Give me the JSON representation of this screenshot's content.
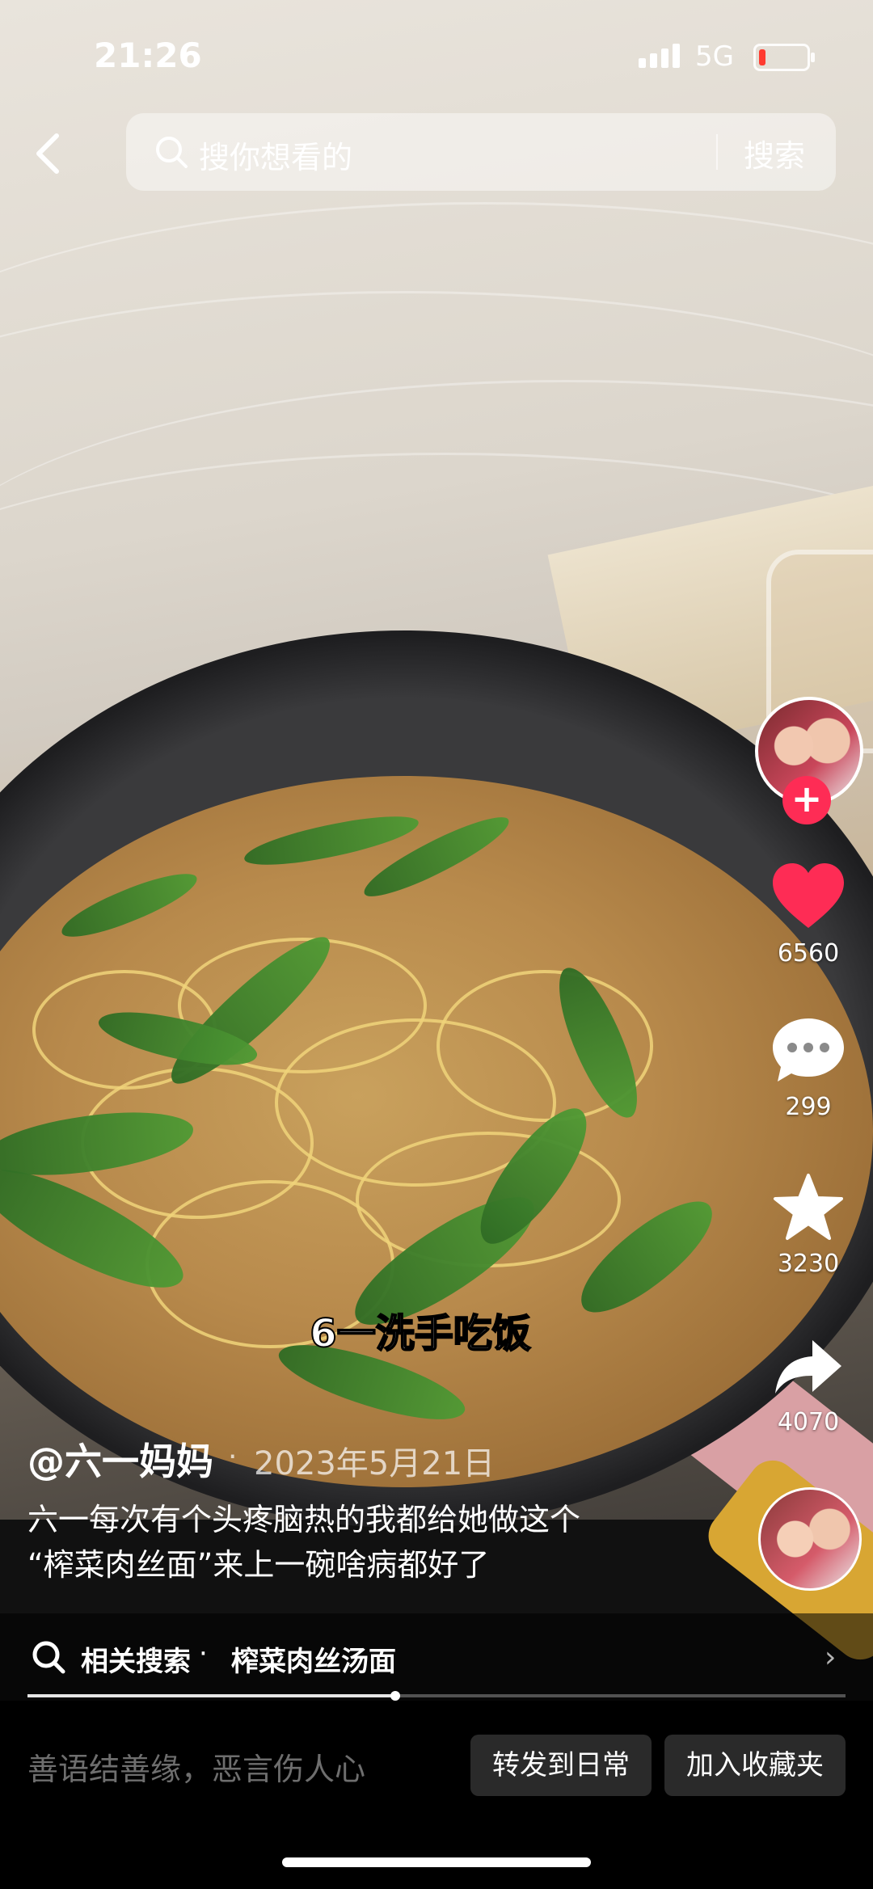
{
  "status_bar": {
    "time": "21:26",
    "network": "5G",
    "battery_fraction": 0.15,
    "battery_color": "#ff3b30"
  },
  "search": {
    "placeholder": "搜你想看的",
    "button_label": "搜索",
    "back_icon": "chevron-left-icon"
  },
  "video": {
    "caption_overlay": "6一洗手吃饭",
    "progress": 0.45
  },
  "sidebar": {
    "like_count": "6560",
    "comment_count": "299",
    "favorite_count": "3230",
    "share_count": "4070",
    "follow_label": "+",
    "like_color": "#fe2c55"
  },
  "post": {
    "author": "@六一妈妈",
    "separator": "·",
    "date": "2023年5月21日",
    "description_line1": "六一每次有个头疼脑热的我都给她做这个",
    "description_line2": "“榨菜肉丝面”来上一碗啥病都好了"
  },
  "related_search": {
    "label": "相关搜索",
    "separator": "·",
    "query": "榨菜肉丝汤面",
    "chevron": "›"
  },
  "bottom_bar": {
    "comment_placeholder": "善语结善缘，恶言伤人心",
    "forward_label": "转发到日常",
    "collect_label": "加入收藏夹"
  }
}
